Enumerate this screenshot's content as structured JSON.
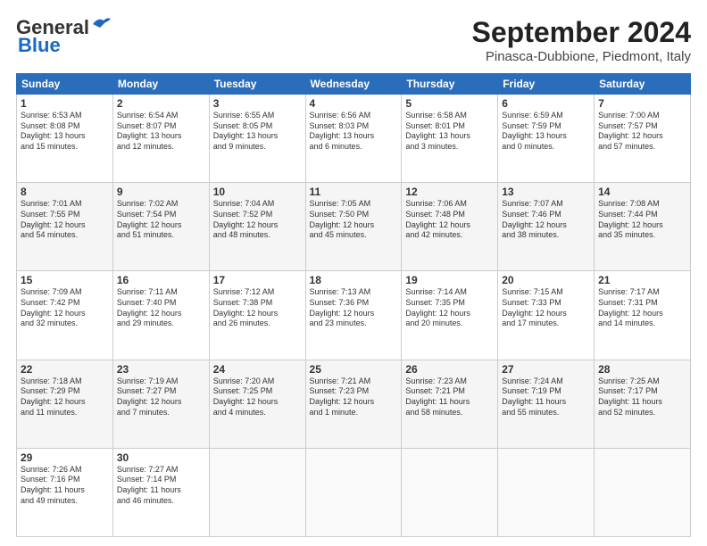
{
  "logo": {
    "line1": "General",
    "line2": "Blue"
  },
  "title": "September 2024",
  "subtitle": "Pinasca-Dubbione, Piedmont, Italy",
  "weekdays": [
    "Sunday",
    "Monday",
    "Tuesday",
    "Wednesday",
    "Thursday",
    "Friday",
    "Saturday"
  ],
  "weeks": [
    [
      {
        "day": "1",
        "lines": [
          "Sunrise: 6:53 AM",
          "Sunset: 8:08 PM",
          "Daylight: 13 hours",
          "and 15 minutes."
        ]
      },
      {
        "day": "2",
        "lines": [
          "Sunrise: 6:54 AM",
          "Sunset: 8:07 PM",
          "Daylight: 13 hours",
          "and 12 minutes."
        ]
      },
      {
        "day": "3",
        "lines": [
          "Sunrise: 6:55 AM",
          "Sunset: 8:05 PM",
          "Daylight: 13 hours",
          "and 9 minutes."
        ]
      },
      {
        "day": "4",
        "lines": [
          "Sunrise: 6:56 AM",
          "Sunset: 8:03 PM",
          "Daylight: 13 hours",
          "and 6 minutes."
        ]
      },
      {
        "day": "5",
        "lines": [
          "Sunrise: 6:58 AM",
          "Sunset: 8:01 PM",
          "Daylight: 13 hours",
          "and 3 minutes."
        ]
      },
      {
        "day": "6",
        "lines": [
          "Sunrise: 6:59 AM",
          "Sunset: 7:59 PM",
          "Daylight: 13 hours",
          "and 0 minutes."
        ]
      },
      {
        "day": "7",
        "lines": [
          "Sunrise: 7:00 AM",
          "Sunset: 7:57 PM",
          "Daylight: 12 hours",
          "and 57 minutes."
        ]
      }
    ],
    [
      {
        "day": "8",
        "lines": [
          "Sunrise: 7:01 AM",
          "Sunset: 7:55 PM",
          "Daylight: 12 hours",
          "and 54 minutes."
        ]
      },
      {
        "day": "9",
        "lines": [
          "Sunrise: 7:02 AM",
          "Sunset: 7:54 PM",
          "Daylight: 12 hours",
          "and 51 minutes."
        ]
      },
      {
        "day": "10",
        "lines": [
          "Sunrise: 7:04 AM",
          "Sunset: 7:52 PM",
          "Daylight: 12 hours",
          "and 48 minutes."
        ]
      },
      {
        "day": "11",
        "lines": [
          "Sunrise: 7:05 AM",
          "Sunset: 7:50 PM",
          "Daylight: 12 hours",
          "and 45 minutes."
        ]
      },
      {
        "day": "12",
        "lines": [
          "Sunrise: 7:06 AM",
          "Sunset: 7:48 PM",
          "Daylight: 12 hours",
          "and 42 minutes."
        ]
      },
      {
        "day": "13",
        "lines": [
          "Sunrise: 7:07 AM",
          "Sunset: 7:46 PM",
          "Daylight: 12 hours",
          "and 38 minutes."
        ]
      },
      {
        "day": "14",
        "lines": [
          "Sunrise: 7:08 AM",
          "Sunset: 7:44 PM",
          "Daylight: 12 hours",
          "and 35 minutes."
        ]
      }
    ],
    [
      {
        "day": "15",
        "lines": [
          "Sunrise: 7:09 AM",
          "Sunset: 7:42 PM",
          "Daylight: 12 hours",
          "and 32 minutes."
        ]
      },
      {
        "day": "16",
        "lines": [
          "Sunrise: 7:11 AM",
          "Sunset: 7:40 PM",
          "Daylight: 12 hours",
          "and 29 minutes."
        ]
      },
      {
        "day": "17",
        "lines": [
          "Sunrise: 7:12 AM",
          "Sunset: 7:38 PM",
          "Daylight: 12 hours",
          "and 26 minutes."
        ]
      },
      {
        "day": "18",
        "lines": [
          "Sunrise: 7:13 AM",
          "Sunset: 7:36 PM",
          "Daylight: 12 hours",
          "and 23 minutes."
        ]
      },
      {
        "day": "19",
        "lines": [
          "Sunrise: 7:14 AM",
          "Sunset: 7:35 PM",
          "Daylight: 12 hours",
          "and 20 minutes."
        ]
      },
      {
        "day": "20",
        "lines": [
          "Sunrise: 7:15 AM",
          "Sunset: 7:33 PM",
          "Daylight: 12 hours",
          "and 17 minutes."
        ]
      },
      {
        "day": "21",
        "lines": [
          "Sunrise: 7:17 AM",
          "Sunset: 7:31 PM",
          "Daylight: 12 hours",
          "and 14 minutes."
        ]
      }
    ],
    [
      {
        "day": "22",
        "lines": [
          "Sunrise: 7:18 AM",
          "Sunset: 7:29 PM",
          "Daylight: 12 hours",
          "and 11 minutes."
        ]
      },
      {
        "day": "23",
        "lines": [
          "Sunrise: 7:19 AM",
          "Sunset: 7:27 PM",
          "Daylight: 12 hours",
          "and 7 minutes."
        ]
      },
      {
        "day": "24",
        "lines": [
          "Sunrise: 7:20 AM",
          "Sunset: 7:25 PM",
          "Daylight: 12 hours",
          "and 4 minutes."
        ]
      },
      {
        "day": "25",
        "lines": [
          "Sunrise: 7:21 AM",
          "Sunset: 7:23 PM",
          "Daylight: 12 hours",
          "and 1 minute."
        ]
      },
      {
        "day": "26",
        "lines": [
          "Sunrise: 7:23 AM",
          "Sunset: 7:21 PM",
          "Daylight: 11 hours",
          "and 58 minutes."
        ]
      },
      {
        "day": "27",
        "lines": [
          "Sunrise: 7:24 AM",
          "Sunset: 7:19 PM",
          "Daylight: 11 hours",
          "and 55 minutes."
        ]
      },
      {
        "day": "28",
        "lines": [
          "Sunrise: 7:25 AM",
          "Sunset: 7:17 PM",
          "Daylight: 11 hours",
          "and 52 minutes."
        ]
      }
    ],
    [
      {
        "day": "29",
        "lines": [
          "Sunrise: 7:26 AM",
          "Sunset: 7:16 PM",
          "Daylight: 11 hours",
          "and 49 minutes."
        ]
      },
      {
        "day": "30",
        "lines": [
          "Sunrise: 7:27 AM",
          "Sunset: 7:14 PM",
          "Daylight: 11 hours",
          "and 46 minutes."
        ]
      },
      null,
      null,
      null,
      null,
      null
    ]
  ]
}
